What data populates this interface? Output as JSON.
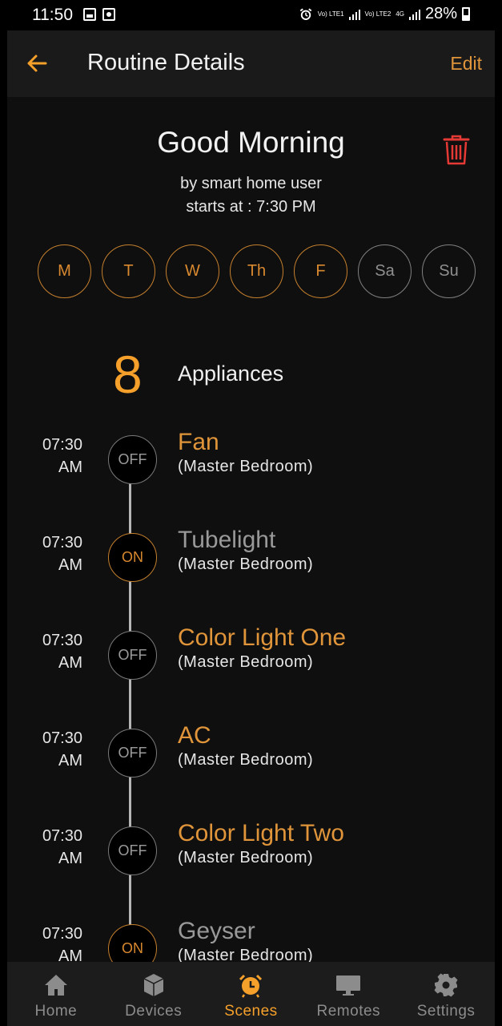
{
  "status_bar": {
    "time": "11:50",
    "left_icons": [
      "gallery-icon",
      "camera-icon"
    ],
    "right_icons": [
      "alarm-icon",
      "volte-lte1-icon",
      "signal-icon",
      "volte-lte2-icon",
      "4g-icon",
      "signal-icon"
    ],
    "lte1": "Vo) LTE1",
    "lte2": "Vo) LTE2",
    "network": "4G",
    "battery": "28%"
  },
  "app_bar": {
    "back_icon": "arrow-left-icon",
    "title": "Routine Details",
    "edit_label": "Edit"
  },
  "routine": {
    "name": "Good Morning",
    "by": "by smart home user",
    "starts_at": "starts at : 7:30 PM",
    "delete_icon": "trash-icon",
    "days": [
      {
        "label": "M",
        "active": true
      },
      {
        "label": "T",
        "active": true
      },
      {
        "label": "W",
        "active": true
      },
      {
        "label": "Th",
        "active": true
      },
      {
        "label": "F",
        "active": true
      },
      {
        "label": "Sa",
        "active": false
      },
      {
        "label": "Su",
        "active": false
      }
    ]
  },
  "appliances": {
    "count": "8",
    "label": "Appliances",
    "items": [
      {
        "time": "07:30",
        "meridiem": "AM",
        "state": "OFF",
        "name": "Fan",
        "room": "(Master Bedroom)"
      },
      {
        "time": "07:30",
        "meridiem": "AM",
        "state": "ON",
        "name": "Tubelight",
        "room": "(Master Bedroom)"
      },
      {
        "time": "07:30",
        "meridiem": "AM",
        "state": "OFF",
        "name": "Color Light One",
        "room": "(Master Bedroom)"
      },
      {
        "time": "07:30",
        "meridiem": "AM",
        "state": "OFF",
        "name": "AC",
        "room": "(Master Bedroom)"
      },
      {
        "time": "07:30",
        "meridiem": "AM",
        "state": "OFF",
        "name": "Color Light Two",
        "room": "(Master Bedroom)"
      },
      {
        "time": "07:30",
        "meridiem": "AM",
        "state": "ON",
        "name": "Geyser",
        "room": "(Master Bedroom)"
      }
    ]
  },
  "bottom_nav": {
    "items": [
      {
        "label": "Home",
        "icon": "home-icon",
        "active": false
      },
      {
        "label": "Devices",
        "icon": "cube-icon",
        "active": false
      },
      {
        "label": "Scenes",
        "icon": "alarm-clock-icon",
        "active": true
      },
      {
        "label": "Remotes",
        "icon": "monitor-icon",
        "active": false
      },
      {
        "label": "Settings",
        "icon": "gear-icon",
        "active": false
      }
    ]
  },
  "colors": {
    "accent": "#f5a02a",
    "delete": "#e53935",
    "background": "#0f0f0f",
    "app_bar": "#1a1a1a"
  }
}
